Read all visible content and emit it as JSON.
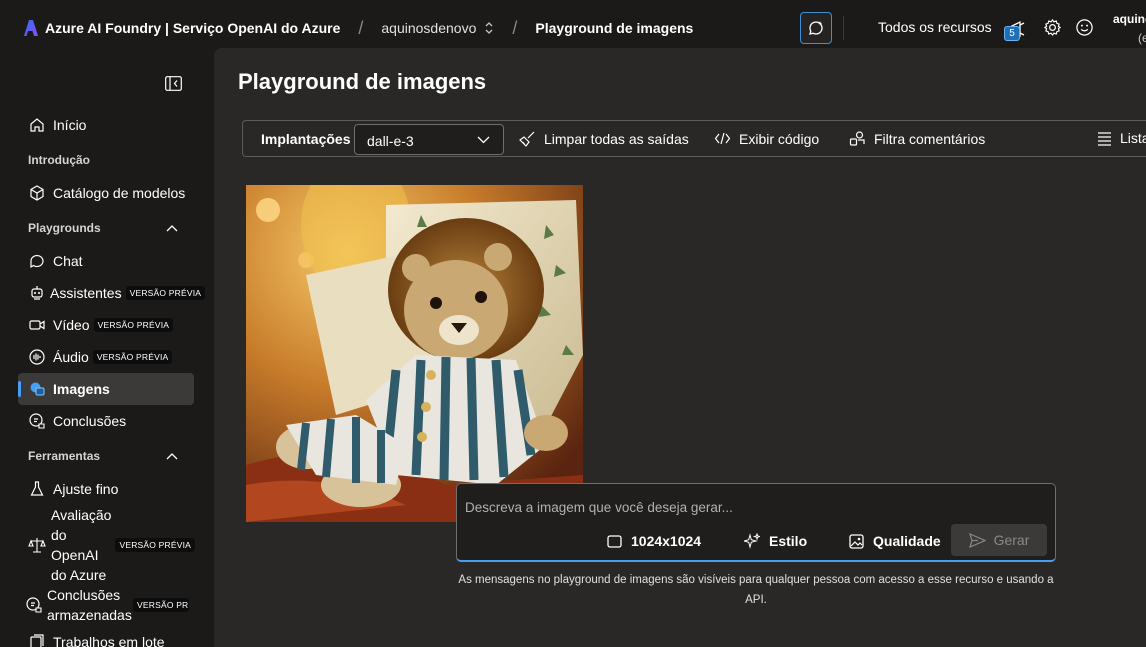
{
  "header": {
    "brand": "Azure AI Foundry | Serviço OpenAI do Azure",
    "project": "aquinosdenovo",
    "page": "Playground de imagens",
    "all_resources": "Todos os recursos",
    "notification_count": "5",
    "user_name": "aquino",
    "user_sub": "(e"
  },
  "sidebar": {
    "items": [
      {
        "label": "Início"
      },
      {
        "label": "Catálogo de modelos"
      },
      {
        "label": "Chat"
      },
      {
        "label": "Assistentes",
        "badge": "VERSÃO PRÉVIA"
      },
      {
        "label": "Vídeo",
        "badge": "VERSÃO PRÉVIA"
      },
      {
        "label": "Áudio",
        "badge": "VERSÃO PRÉVIA"
      },
      {
        "label": "Imagens"
      },
      {
        "label": "Conclusões"
      },
      {
        "label": "Ajuste fino"
      },
      {
        "label": "Avaliação do OpenAI do Azure",
        "lines": [
          "Avaliação",
          "do",
          "OpenAI",
          "do Azure"
        ],
        "badge": "VERSÃO PRÉVIA"
      },
      {
        "label": "Conclusões armazenadas",
        "lines": [
          "Conclusões",
          "armazenadas"
        ],
        "badge": "VERSÃO PRÉV"
      },
      {
        "label": "Trabalhos em lote"
      }
    ],
    "sections": {
      "intro": "Introdução",
      "playgrounds": "Playgrounds",
      "tools": "Ferramentas"
    }
  },
  "main": {
    "title": "Playground de imagens",
    "toolbar": {
      "deployments_label": "Implantações",
      "deployment_value": "dall-e-3",
      "clear_label": "Limpar todas as saídas",
      "code_label": "Exibir código",
      "filter_label": "Filtra comentários",
      "list_label": "Lista"
    },
    "prompt": {
      "placeholder": "Descreva a imagem que você deseja gerar...",
      "size": "1024x1024",
      "style": "Estilo",
      "quality": "Qualidade",
      "generate": "Gerar"
    },
    "disclaimer": "As mensagens no playground de imagens são visíveis para qualquer pessoa com acesso a esse recurso e usando a API."
  },
  "colors": {
    "accent": "#479ef5",
    "background": "#1b1a19",
    "panel": "#292827"
  }
}
